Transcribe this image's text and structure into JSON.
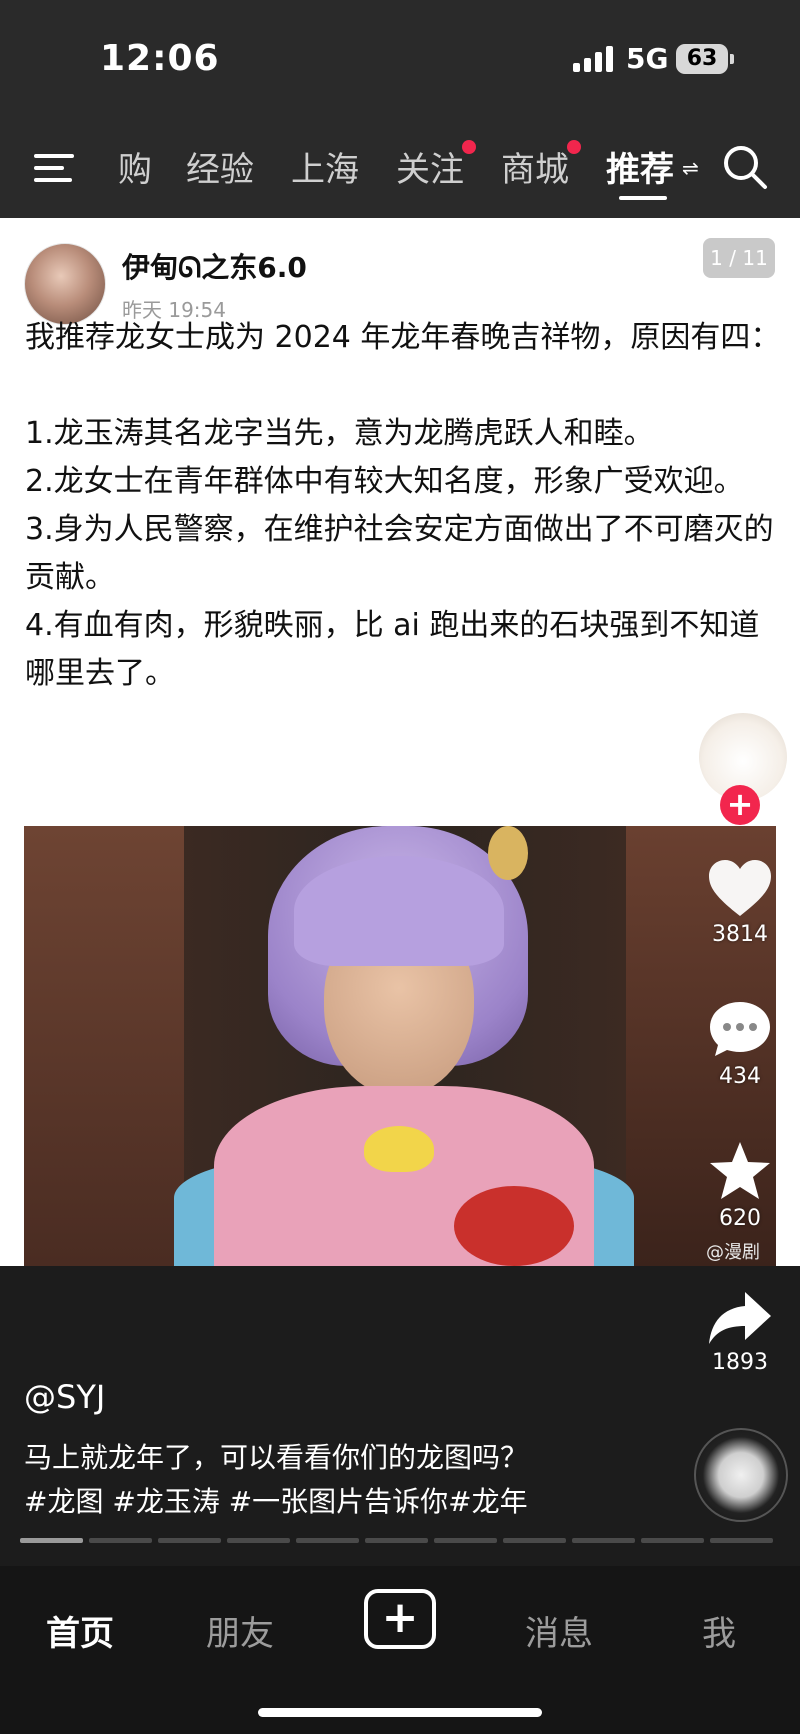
{
  "status_bar": {
    "time": "12:06",
    "network": "5G",
    "battery": "63"
  },
  "top_nav": {
    "tabs": [
      {
        "label": "团购",
        "partial": "购"
      },
      {
        "label": "经验"
      },
      {
        "label": "上海"
      },
      {
        "label": "关注",
        "has_dot": true
      },
      {
        "label": "商城",
        "has_dot": true
      },
      {
        "label": "推荐",
        "active": true
      }
    ],
    "dot_color": "#f2264d"
  },
  "post": {
    "author": "伊甸ᘏ之东6.0",
    "time": "昨天 19:54",
    "page_indicator": "1 / 11",
    "text": "我推荐龙女士成为 2024 年龙年春晚吉祥物，原因有四：\n\n1.龙玉涛其名龙字当先，意为龙腾虎跃人和睦。\n2.龙女士在青年群体中有较大知名度，形象广受欢迎。\n3.身为人民警察，在维护社会安定方面做出了不可磨灭的贡献。\n4.有血有肉，形貌昳丽，比 ai 跑出来的石块强到不知道哪里去了。"
  },
  "actions": {
    "likes": "3814",
    "comments": "434",
    "favorites": "620",
    "shares": "1893",
    "follow": "+"
  },
  "watermark": "@漫剧",
  "caption": {
    "username": "@SYJ",
    "text": "马上就龙年了，可以看看你们的龙图吗？",
    "hashtags": "#龙图 #龙玉涛 #一张图片告诉你#龙年"
  },
  "progress": {
    "total": 11,
    "current": 1
  },
  "bottom_bar": {
    "home": "首页",
    "friends": "朋友",
    "create": "+",
    "messages": "消息",
    "me": "我"
  },
  "colors": {
    "accent": "#f2264d",
    "background": "#1c1c1c",
    "card": "#ffffff"
  }
}
